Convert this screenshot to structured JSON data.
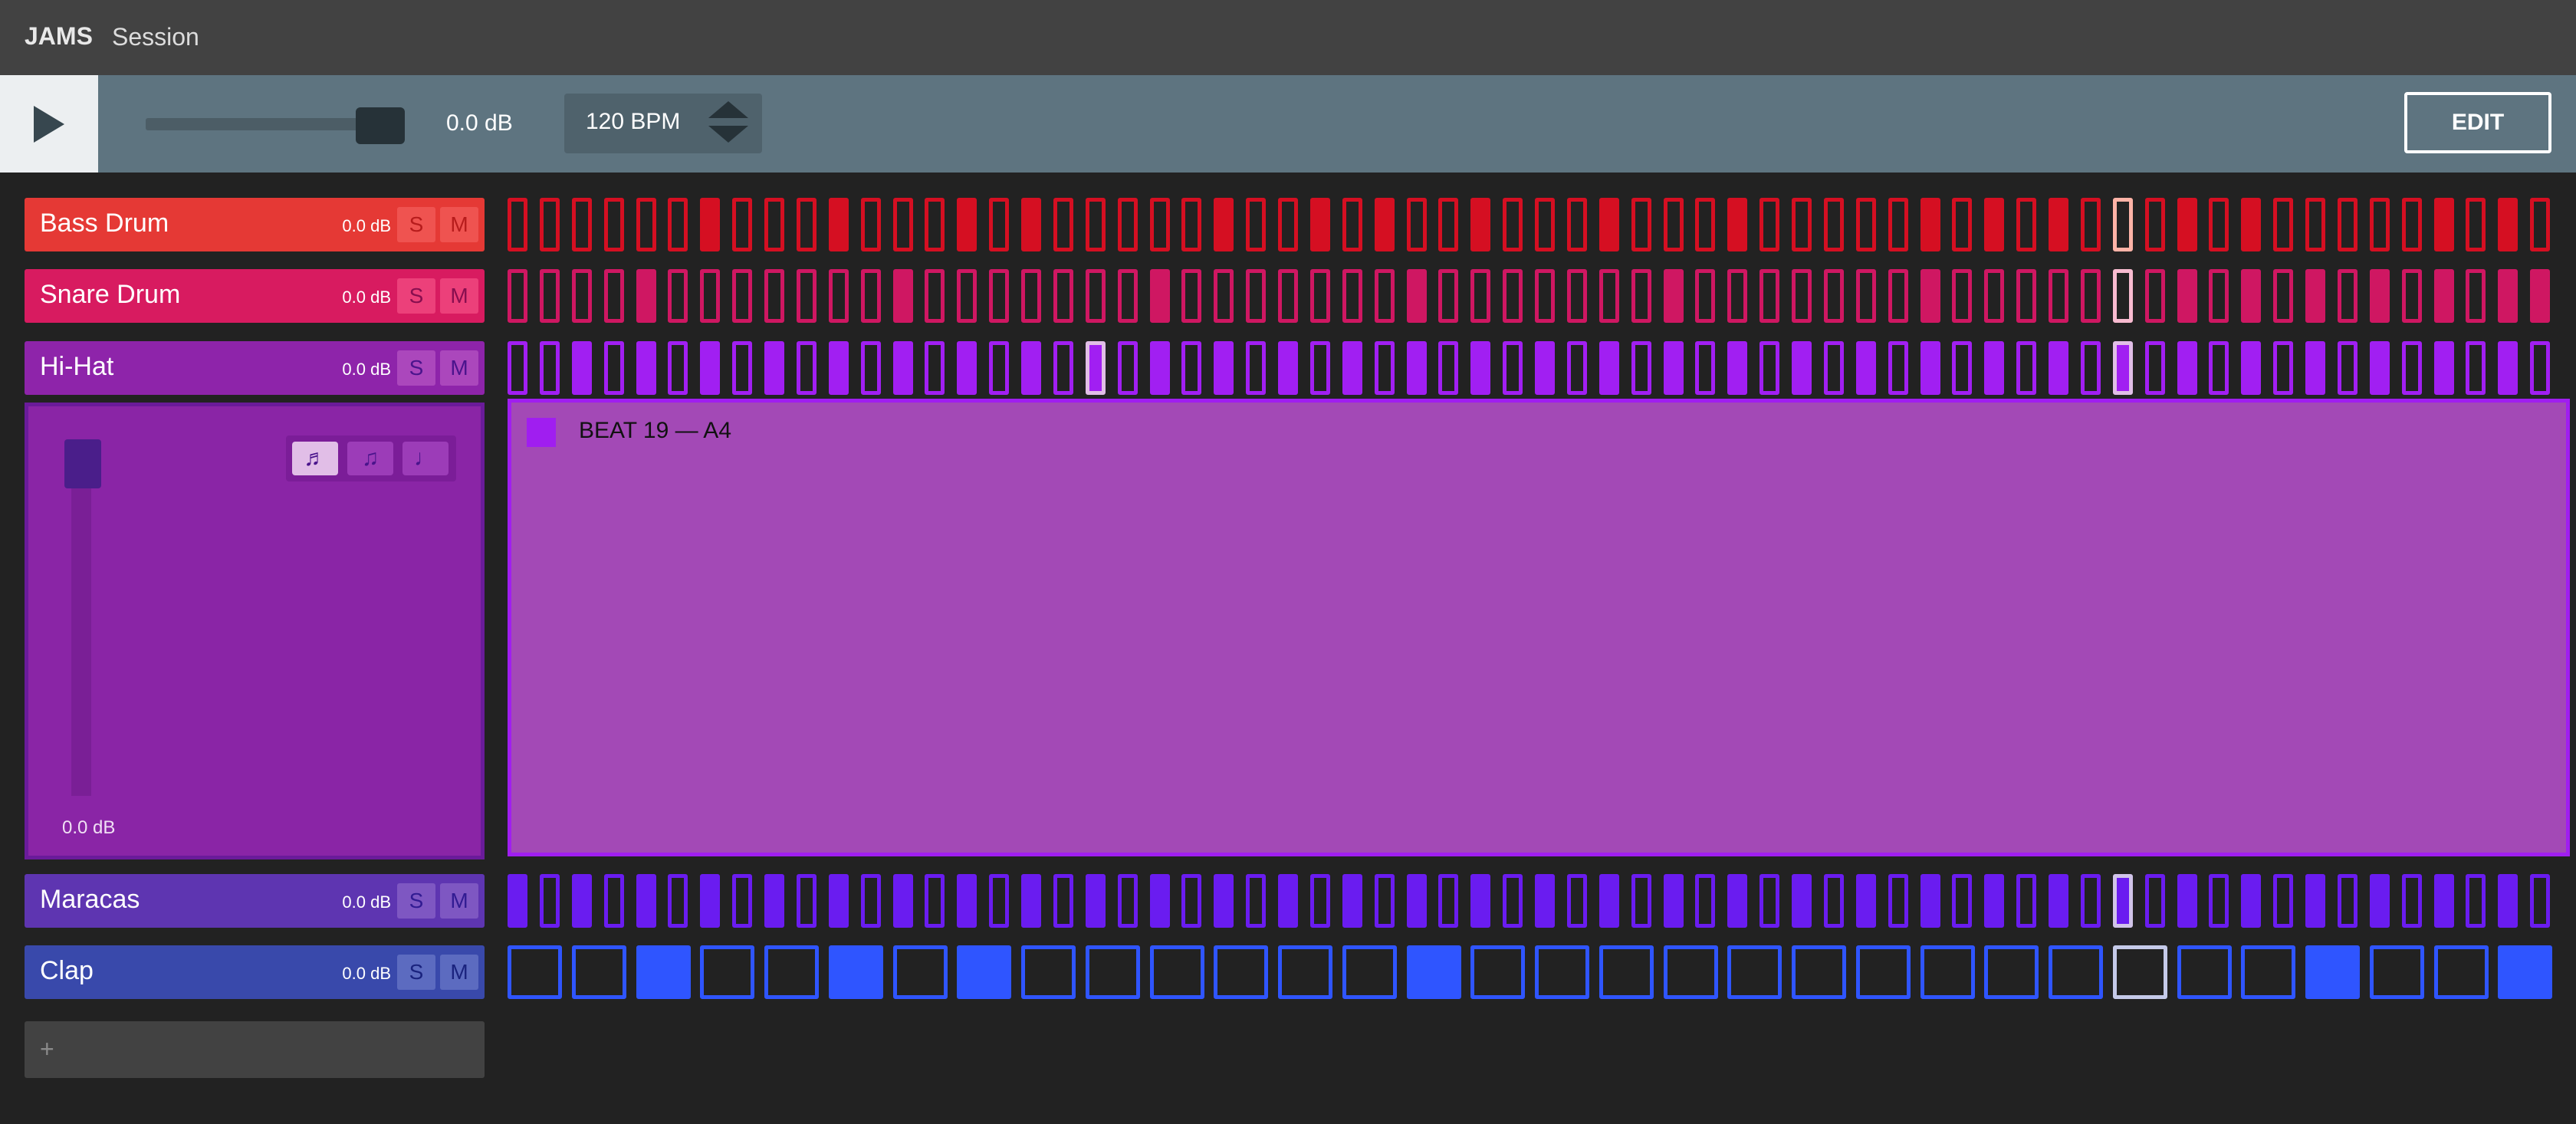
{
  "header": {
    "brand": "JAMS",
    "session": "Session"
  },
  "transport": {
    "volume_label": "0.0 dB",
    "volume_level": 0.9,
    "bpm_label": "120 BPM",
    "edit_label": "EDIT"
  },
  "tracks": [
    {
      "name": "Bass Drum",
      "db": "0.0 dB",
      "solo": "S",
      "mute": "M",
      "color": "#e53935",
      "btn_color": "#ef5350",
      "btn_text": "#b71c1c",
      "step_color": "#d50f22",
      "playhead_color": "#ffb3a7"
    },
    {
      "name": "Snare Drum",
      "db": "0.0 dB",
      "solo": "S",
      "mute": "M",
      "color": "#d81b60",
      "btn_color": "#ec407a",
      "btn_text": "#880e4f",
      "step_color": "#cf1762",
      "playhead_color": "#f8bbd0"
    },
    {
      "name": "Hi-Hat",
      "db": "0.0 dB",
      "solo": "S",
      "mute": "M",
      "color": "#8e24aa",
      "btn_color": "#ab47bc",
      "btn_text": "#4a148c",
      "step_color": "#a11ff2",
      "playhead_color": "#e1bee7"
    },
    {
      "name": "Maracas",
      "db": "0.0 dB",
      "solo": "S",
      "mute": "M",
      "color": "#5e35b1",
      "btn_color": "#7e57c2",
      "btn_text": "#311b92",
      "step_color": "#6a1cf0",
      "playhead_color": "#d1c4e9"
    },
    {
      "name": "Clap",
      "db": "0.0 dB",
      "solo": "S",
      "mute": "M",
      "color": "#3949ab",
      "btn_color": "#5c6bc0",
      "btn_text": "#1a237e",
      "step_color": "#2f55ff",
      "playhead_color": "#c5cae9"
    }
  ],
  "expanded_track": {
    "db": "0.0 dB",
    "volume_level": 1.0,
    "note_icons": [
      "eighth-notes-icon",
      "beamed-notes-icon",
      "quarter-note-icon"
    ],
    "note_glyphs": [
      "♬",
      "♫",
      "♩"
    ],
    "selected_note": 0
  },
  "beat_panel": {
    "label": "BEAT 19 — A4"
  },
  "add_track": {
    "label": "+"
  },
  "sequencer": {
    "steps": 64,
    "playhead": 50,
    "rows": [
      {
        "track": 0,
        "steps": 64,
        "active": [
          6,
          10,
          14,
          16,
          22,
          25,
          27,
          30,
          34,
          38,
          44,
          46,
          48,
          52,
          54,
          60,
          62
        ],
        "highlight": [
          50
        ]
      },
      {
        "track": 1,
        "steps": 64,
        "active": [
          4,
          12,
          20,
          28,
          36,
          44,
          52,
          54,
          56,
          58,
          60,
          62,
          63
        ],
        "highlight": [
          50
        ]
      },
      {
        "track": 2,
        "steps": 64,
        "active": [
          2,
          4,
          6,
          8,
          10,
          12,
          14,
          16,
          18,
          20,
          22,
          24,
          26,
          28,
          30,
          32,
          34,
          36,
          38,
          40,
          42,
          44,
          46,
          48,
          50,
          52,
          54,
          56,
          58,
          60,
          62
        ],
        "highlight": [
          18,
          50
        ]
      },
      {
        "track": 3,
        "steps": 64,
        "active": [
          0,
          2,
          4,
          6,
          8,
          10,
          12,
          14,
          16,
          18,
          20,
          22,
          24,
          26,
          28,
          30,
          32,
          34,
          36,
          38,
          40,
          42,
          44,
          46,
          48,
          50,
          52,
          54,
          56,
          58,
          60,
          62
        ],
        "highlight": [
          50
        ]
      },
      {
        "track": 4,
        "steps": 32,
        "active": [
          2,
          5,
          7,
          14,
          28,
          31
        ],
        "highlight": [
          25
        ]
      }
    ]
  }
}
